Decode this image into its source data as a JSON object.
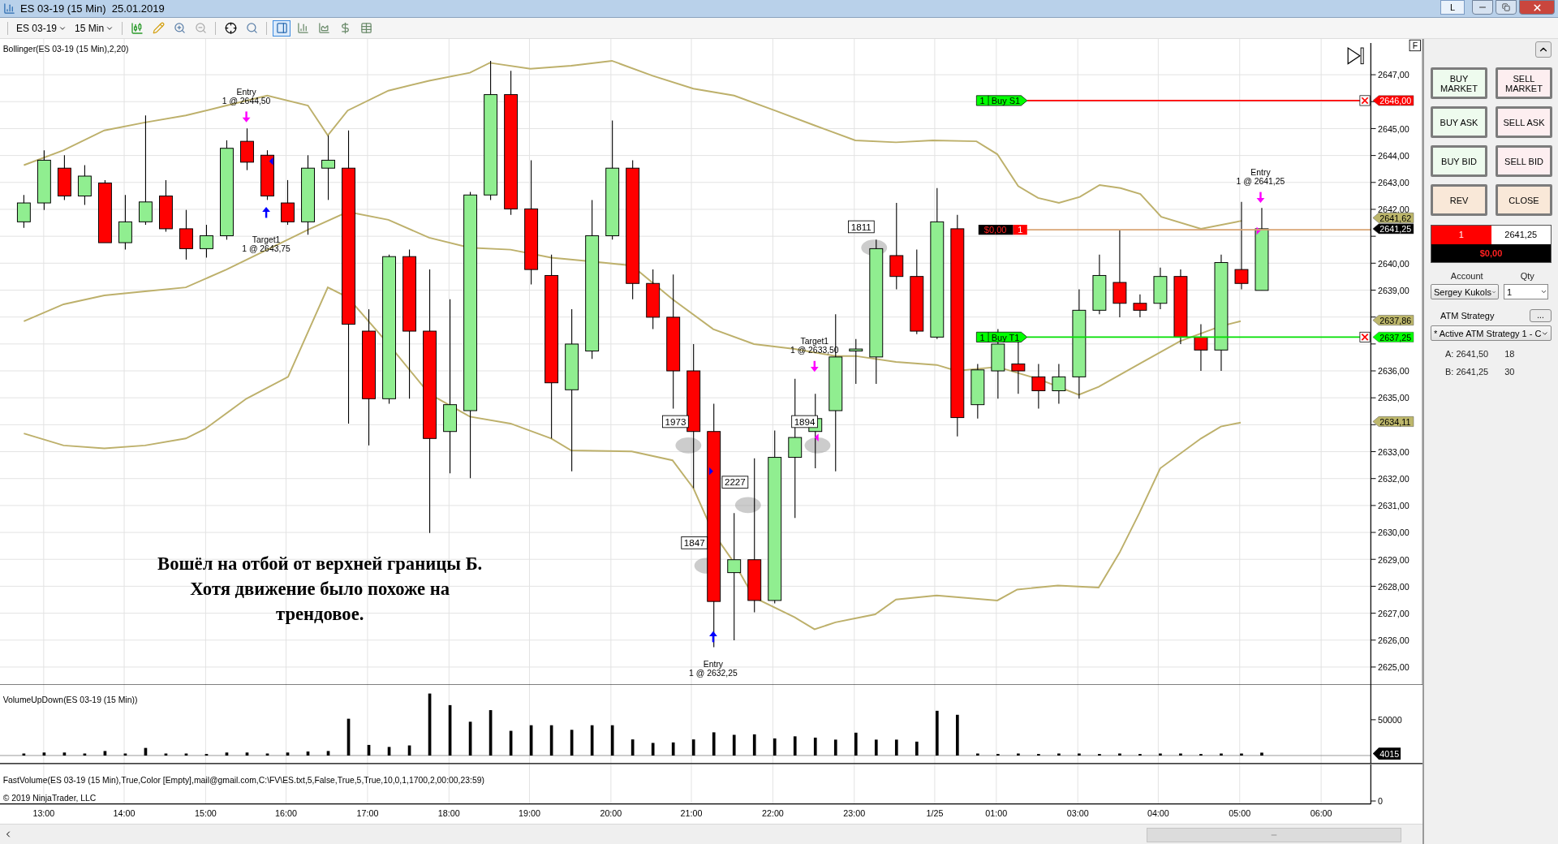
{
  "window": {
    "title": "ES 03-19 (15 Min)  25.01.2019",
    "link_button": "L"
  },
  "toolbar": {
    "instrument": "ES 03-19",
    "interval": "15 Min",
    "buttons": [
      {
        "kind": "chart-trader",
        "selected": true
      },
      {
        "kind": "data-box",
        "selected": false
      },
      {
        "kind": "indicators",
        "selected": false
      },
      {
        "kind": "strategies",
        "selected": false
      },
      {
        "kind": "properties",
        "selected": false
      }
    ]
  },
  "price_panel": {
    "indicator_label": "Bollinger(ES 03-19 (15 Min),2,20)",
    "panel_button": "F",
    "axis_labels": [
      "2647,00",
      "2645,00",
      "2644,00",
      "2643,00",
      "2642,00",
      "2640,00",
      "2639,00",
      "2636,00",
      "2635,00",
      "2633,00",
      "2632,00",
      "2631,00",
      "2630,00",
      "2629,00",
      "2628,00",
      "2627,00",
      "2626,00",
      "2625,00"
    ],
    "axis_badges": [
      {
        "text": "2646,00",
        "color": "#ff0000"
      },
      {
        "text": "2641,62",
        "color": "#bdb76b"
      },
      {
        "text": "2641,25",
        "color": "#000000"
      },
      {
        "text": "2637,86",
        "color": "#bdb76b"
      },
      {
        "text": "2637,25",
        "color": "#00ff00"
      },
      {
        "text": "2634,11",
        "color": "#bdb76b"
      }
    ],
    "order_lines": [
      {
        "kind": "stop",
        "quantity": "1",
        "label": "Buy S1"
      },
      {
        "kind": "position",
        "pnl": "$0,00",
        "quantity": "1"
      },
      {
        "kind": "target",
        "quantity": "1",
        "label": "Buy T1"
      }
    ],
    "trade_markers": [
      {
        "label": "Entry",
        "detail": "1 @ 2644,50",
        "kind": "sell"
      },
      {
        "label": "Target1",
        "detail": "1 @ 2643,75",
        "kind": "buy"
      },
      {
        "label": "Target1",
        "detail": "1 @ 2633,50",
        "kind": "sell"
      },
      {
        "label": "Entry",
        "detail": "1 @ 2632,25",
        "kind": "buy"
      },
      {
        "label": "Entry",
        "detail": "1 @ 2641,25",
        "kind": "sell"
      }
    ],
    "volume_labels": [
      "1811",
      "1973",
      "1894",
      "2227",
      "1847"
    ],
    "comment_lines": [
      "Вошёл на отбой от верхней границы Б.",
      "Хотя движение было похоже на",
      "трендовое."
    ]
  },
  "volume_panel": {
    "label": "VolumeUpDown(ES 03-19 (15 Min))",
    "axis_label": "50000",
    "badge": "4015"
  },
  "fast_volume_panel": {
    "label": "FastVolume(ES 03-19 (15 Min),True,Color [Empty],mail@gmail.com,C:\\FV\\ES.txt,5,False,True,5,True,10,0,1,1700,2,00:00,23:59)",
    "copyright": "© 2019 NinjaTrader, LLC",
    "axis_label": "0"
  },
  "time_axis": [
    "13:00",
    "14:00",
    "15:00",
    "16:00",
    "17:00",
    "18:00",
    "19:00",
    "20:00",
    "21:00",
    "22:00",
    "23:00",
    "1/25",
    "01:00",
    "03:00",
    "04:00",
    "05:00",
    "06:00"
  ],
  "chart_trader": {
    "buttons": [
      {
        "kind": "buy",
        "label": "BUY\nMARKET"
      },
      {
        "kind": "sell",
        "label": "SELL\nMARKET"
      },
      {
        "kind": "buy",
        "label": "BUY ASK"
      },
      {
        "kind": "sell",
        "label": "SELL ASK"
      },
      {
        "kind": "buy",
        "label": "BUY BID"
      },
      {
        "kind": "sell",
        "label": "SELL BID"
      },
      {
        "kind": "neutral",
        "label": "REV"
      },
      {
        "kind": "neutral",
        "label": "CLOSE"
      }
    ],
    "position": {
      "quantity": "1",
      "average_price": "2641,25",
      "pnl": "$0,00"
    },
    "account_label": "Account",
    "account": "Sergey Kukols",
    "qty_label": "Qty",
    "qty": "1",
    "atm_label": "ATM Strategy",
    "atm_button": "...",
    "atm_strategy": "* Active ATM Strategy 1 - C",
    "quotes": [
      {
        "label": "A: 2641,50",
        "size": "18"
      },
      {
        "label": "B: 2641,25",
        "size": "30"
      }
    ]
  }
}
